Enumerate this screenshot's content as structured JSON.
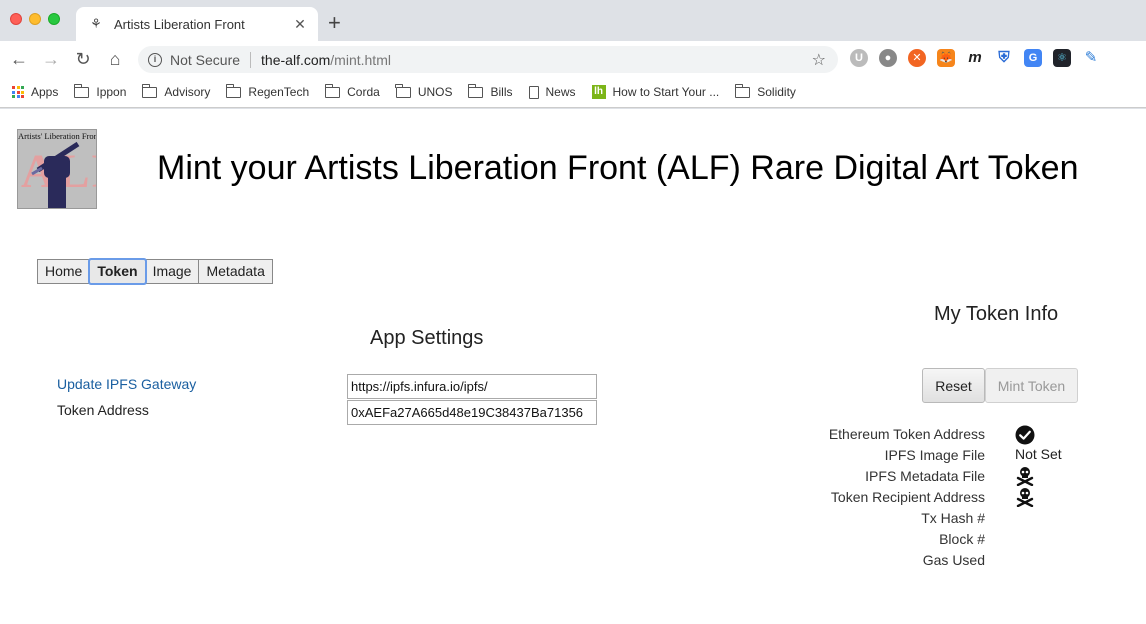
{
  "browser": {
    "tab_title": "Artists Liberation Front",
    "not_secure": "Not Secure",
    "url_host": "the-alf.com",
    "url_path": "/mint.html",
    "bookmarks": [
      {
        "label": "Apps",
        "icon": "apps-grid-icon"
      },
      {
        "label": "Ippon",
        "icon": "folder-icon"
      },
      {
        "label": "Advisory",
        "icon": "folder-icon"
      },
      {
        "label": "RegenTech",
        "icon": "folder-icon"
      },
      {
        "label": "Corda",
        "icon": "folder-icon"
      },
      {
        "label": "UNOS",
        "icon": "folder-icon"
      },
      {
        "label": "Bills",
        "icon": "folder-icon"
      },
      {
        "label": "News",
        "icon": "document-icon"
      },
      {
        "label": "How to Start Your ...",
        "icon": "ih-icon"
      },
      {
        "label": "Solidity",
        "icon": "folder-icon"
      }
    ]
  },
  "logo": {
    "text": "Artists' Liberation Front",
    "letters": "ALF"
  },
  "page": {
    "title": "Mint your Artists Liberation Front (ALF) Rare Digital Art Token"
  },
  "nav_tabs": [
    {
      "label": "Home",
      "active": false
    },
    {
      "label": "Token",
      "active": true
    },
    {
      "label": "Image",
      "active": false
    },
    {
      "label": "Metadata",
      "active": false
    }
  ],
  "settings": {
    "heading": "App Settings",
    "ipfs_label": "Update IPFS Gateway",
    "ipfs_value": "https://ipfs.infura.io/ipfs/",
    "token_label": "Token Address",
    "token_value": "0xAEFa27A665d48e19C38437Ba71356"
  },
  "token_info": {
    "heading": "My Token Info",
    "reset_label": "Reset",
    "mint_label": "Mint Token",
    "labels": [
      "Ethereum Token Address",
      "IPFS Image File",
      "IPFS Metadata File",
      "Token Recipient Address",
      "Tx Hash #",
      "Block #",
      "Gas Used"
    ],
    "image_file_status": "Not Set",
    "status_icons": [
      "check-circle-icon",
      "skull-crossbones-icon",
      "skull-crossbones-icon"
    ]
  },
  "colors": {
    "link": "#1a5fa0",
    "active_tab_outline": "#6a9be8"
  }
}
